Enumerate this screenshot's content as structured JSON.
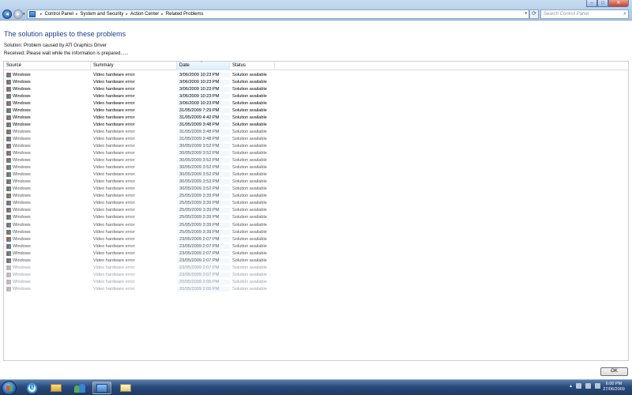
{
  "window": {
    "controls": {
      "minimize": "–",
      "maximize": "□",
      "close": "✕"
    }
  },
  "address_bar": {
    "breadcrumbs": [
      "Control Panel",
      "System and Security",
      "Action Center",
      "Related Problems"
    ],
    "search_placeholder": "Search Control Panel"
  },
  "content": {
    "heading": "The solution applies to these problems",
    "solution": "Solution: Problem caused by ATI Graphics Driver",
    "received": "Received: Please wait while the information is prepared......"
  },
  "table": {
    "columns": [
      "Source",
      "Summary",
      "Date",
      "Status"
    ],
    "rows": [
      {
        "source": "Windows",
        "summary": "Video hardware error",
        "date": "3/06/2009 10:23 PM",
        "status": "Solution available"
      },
      {
        "source": "Windows",
        "summary": "Video hardware error",
        "date": "3/06/2009 10:23 PM",
        "status": "Solution available"
      },
      {
        "source": "Windows",
        "summary": "Video hardware error",
        "date": "3/06/2009 10:23 PM",
        "status": "Solution available"
      },
      {
        "source": "Windows",
        "summary": "Video hardware error",
        "date": "3/06/2009 10:23 PM",
        "status": "Solution available"
      },
      {
        "source": "Windows",
        "summary": "Video hardware error",
        "date": "3/06/2009 10:23 PM",
        "status": "Solution available"
      },
      {
        "source": "Windows",
        "summary": "Video hardware error",
        "date": "31/05/2009 7:29 PM",
        "status": "Solution available"
      },
      {
        "source": "Windows",
        "summary": "Video hardware error",
        "date": "31/05/2009 4:42 PM",
        "status": "Solution available"
      },
      {
        "source": "Windows",
        "summary": "Video hardware error",
        "date": "31/05/2009 3:48 PM",
        "status": "Solution available"
      },
      {
        "source": "Windows",
        "summary": "Video hardware error",
        "date": "31/05/2009 3:48 PM",
        "status": "Solution available"
      },
      {
        "source": "Windows",
        "summary": "Video hardware error",
        "date": "31/05/2009 3:48 PM",
        "status": "Solution available"
      },
      {
        "source": "Windows",
        "summary": "Video hardware error",
        "date": "30/05/2009 3:52 PM",
        "status": "Solution available"
      },
      {
        "source": "Windows",
        "summary": "Video hardware error",
        "date": "30/05/2009 3:52 PM",
        "status": "Solution available"
      },
      {
        "source": "Windows",
        "summary": "Video hardware error",
        "date": "30/05/2009 3:52 PM",
        "status": "Solution available"
      },
      {
        "source": "Windows",
        "summary": "Video hardware error",
        "date": "30/05/2009 3:52 PM",
        "status": "Solution available"
      },
      {
        "source": "Windows",
        "summary": "Video hardware error",
        "date": "30/05/2009 3:52 PM",
        "status": "Solution available"
      },
      {
        "source": "Windows",
        "summary": "Video hardware error",
        "date": "30/05/2009 3:52 PM",
        "status": "Solution available"
      },
      {
        "source": "Windows",
        "summary": "Video hardware error",
        "date": "30/05/2009 3:52 PM",
        "status": "Solution available"
      },
      {
        "source": "Windows",
        "summary": "Video hardware error",
        "date": "25/05/2009 3:39 PM",
        "status": "Solution available"
      },
      {
        "source": "Windows",
        "summary": "Video hardware error",
        "date": "25/05/2009 3:39 PM",
        "status": "Solution available"
      },
      {
        "source": "Windows",
        "summary": "Video hardware error",
        "date": "25/05/2009 3:39 PM",
        "status": "Solution available"
      },
      {
        "source": "Windows",
        "summary": "Video hardware error",
        "date": "25/05/2009 3:39 PM",
        "status": "Solution available"
      },
      {
        "source": "Windows",
        "summary": "Video hardware error",
        "date": "25/05/2009 3:39 PM",
        "status": "Solution available"
      },
      {
        "source": "Windows",
        "summary": "Video hardware error",
        "date": "25/05/2009 3:39 PM",
        "status": "Solution available"
      },
      {
        "source": "Windows",
        "summary": "Video hardware error",
        "date": "23/05/2009 2:07 PM",
        "status": "Solution available"
      },
      {
        "source": "Windows",
        "summary": "Video hardware error",
        "date": "23/05/2009 2:07 PM",
        "status": "Solution available"
      },
      {
        "source": "Windows",
        "summary": "Video hardware error",
        "date": "23/05/2009 2:07 PM",
        "status": "Solution available"
      },
      {
        "source": "Windows",
        "summary": "Video hardware error",
        "date": "23/05/2009 2:07 PM",
        "status": "Solution available"
      },
      {
        "source": "Windows",
        "summary": "Video hardware error",
        "date": "23/05/2009 2:07 PM",
        "status": "Solution available"
      },
      {
        "source": "Windows",
        "summary": "Video hardware error",
        "date": "23/05/2009 2:07 PM",
        "status": "Solution available"
      },
      {
        "source": "Windows",
        "summary": "Video hardware error",
        "date": "20/05/2009 2:05 PM",
        "status": "Solution available"
      },
      {
        "source": "Windows",
        "summary": "Video hardware error",
        "date": "20/05/2009 2:05 PM",
        "status": "Solution available"
      }
    ]
  },
  "buttons": {
    "ok": "OK"
  },
  "taskbar": {
    "clock_time": "6:00 PM",
    "clock_date": "27/06/2009"
  }
}
